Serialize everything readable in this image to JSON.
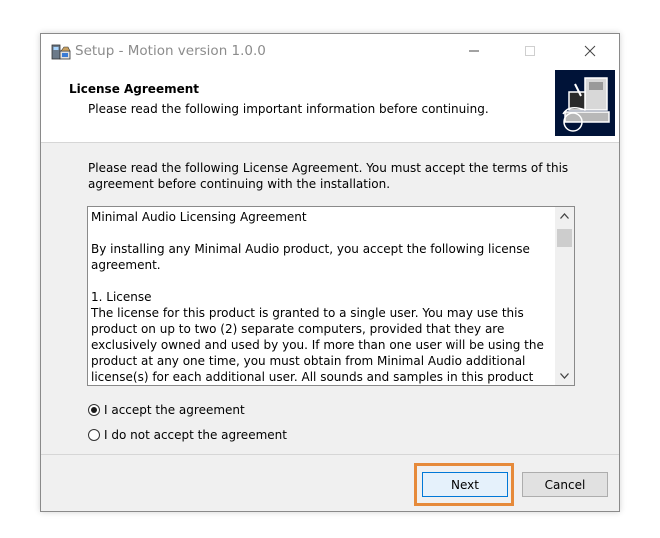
{
  "window": {
    "title": "Setup - Motion version 1.0.0"
  },
  "header": {
    "title": "License Agreement",
    "subtitle": "Please read the following important information before continuing."
  },
  "intro_text": "Please read the following License Agreement. You must accept the terms of this agreement before continuing with the installation.",
  "license_text": "Minimal Audio Licensing Agreement\n\nBy installing any Minimal Audio product, you accept the following license agreement.\n\n1. License\nThe license for this product is granted to a single user. You may use this product on up to two (2) separate computers, provided that they are exclusively owned and used by you. If more than one user will be using the product at any one time, you must obtain from Minimal Audio additional license(s) for each additional user. All sounds and samples in this product are licensed but not sold",
  "options": {
    "accept": {
      "label": "I accept the agreement",
      "selected": true
    },
    "decline": {
      "label": "I do not accept the agreement",
      "selected": false
    }
  },
  "buttons": {
    "next": "Next",
    "cancel": "Cancel"
  },
  "colors": {
    "highlight": "#e68a3a",
    "header_image_bg": "#001338",
    "default_button_border": "#0078d7"
  },
  "icons": {
    "app": "setup-installer-icon",
    "minimize": "minimize-icon",
    "maximize": "maximize-icon",
    "close": "close-icon",
    "scroll_up": "chevron-up-icon",
    "scroll_down": "chevron-down-icon"
  }
}
